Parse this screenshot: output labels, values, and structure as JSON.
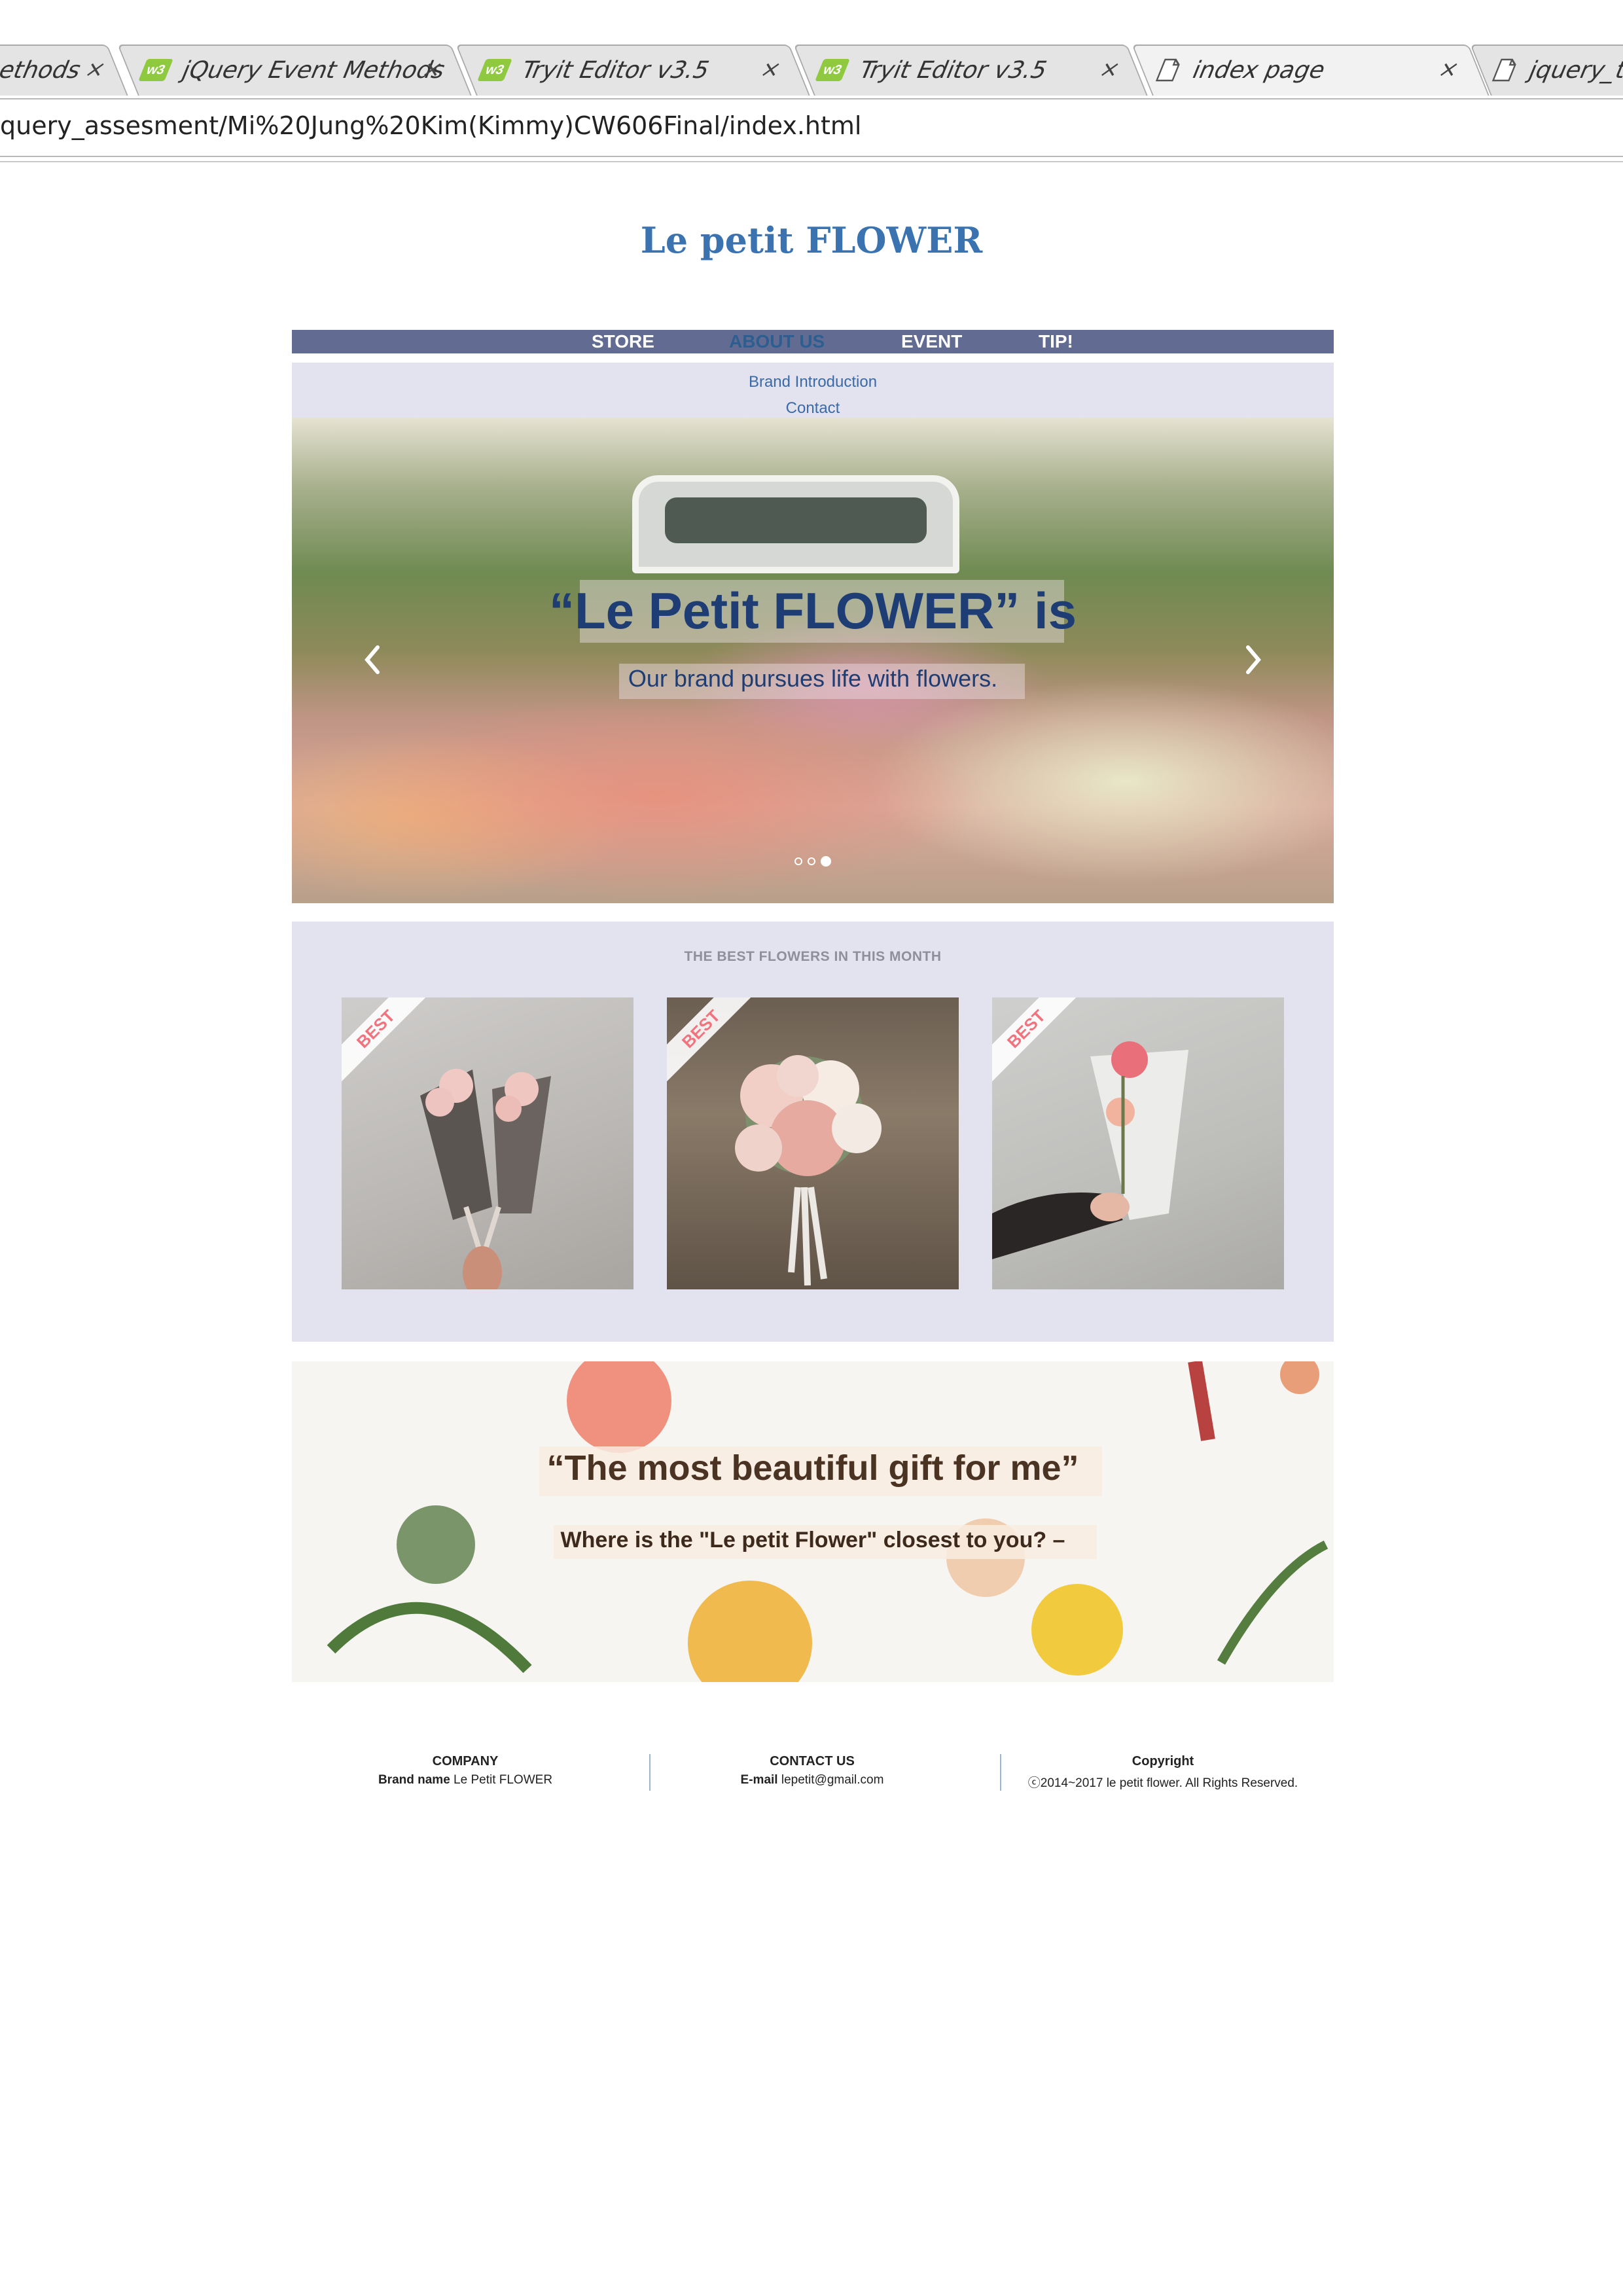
{
  "browser": {
    "tabs": [
      {
        "title": "ethods",
        "icon": "none",
        "active": false
      },
      {
        "title": "jQuery Event Methods",
        "icon": "w3-icon",
        "active": false
      },
      {
        "title": "Tryit Editor v3.5",
        "icon": "w3-icon",
        "active": false
      },
      {
        "title": "Tryit Editor v3.5",
        "icon": "w3-icon",
        "active": false
      },
      {
        "title": "index page",
        "icon": "page-icon",
        "active": true
      },
      {
        "title": "jquery_te",
        "icon": "page-icon",
        "active": false
      }
    ],
    "close_glyph": "×",
    "w3_badge": "w3",
    "url": "query_assesment/Mi%20Jung%20Kim(Kimmy)CW606Final/index.html"
  },
  "site": {
    "logo": "Le petit FLOWER",
    "nav": [
      {
        "label": "STORE",
        "active": false
      },
      {
        "label": "ABOUT US",
        "active": true
      },
      {
        "label": "EVENT",
        "active": false
      },
      {
        "label": "TIP!",
        "active": false
      }
    ],
    "dropdown": [
      "Brand Introduction",
      "Contact"
    ],
    "hero": {
      "title": "“Le Petit FLOWER” is",
      "subtitle": "Our brand pursues life with flowers.",
      "slide_count": 3,
      "active_slide": 3
    },
    "best": {
      "heading": "THE BEST FLOWERS IN THIS MONTH",
      "badge": "BEST",
      "cards": [
        {
          "name": "mini-bouquet-hand"
        },
        {
          "name": "peony-bouquet"
        },
        {
          "name": "ranunculus-single"
        }
      ]
    },
    "banner": {
      "title": "“The most beautiful gift for me”",
      "subtitle": "Where is the \"Le petit Flower\" closest to you? –"
    },
    "footer": {
      "company_head": "COMPANY",
      "company_label": "Brand name",
      "company_value": "Le Petit FLOWER",
      "contact_head": "CONTACT US",
      "contact_label": "E-mail",
      "contact_value": "lepetit@gmail.com",
      "copyright_head": "Copyright",
      "copyright_text": "ⓒ2014~2017 le petit flower. All Rights Reserved."
    }
  },
  "colors": {
    "logo": "#3a73b0",
    "nav_bar": "#626b91",
    "nav_active": "#2e5e8f",
    "section_bg": "#e3e3ef",
    "hero_text": "#1d3d74",
    "badge_text": "#f2727e"
  }
}
